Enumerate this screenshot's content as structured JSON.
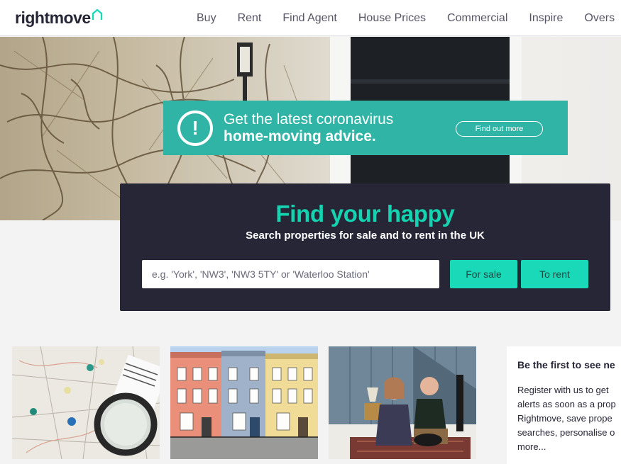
{
  "header": {
    "logo_text": "rightmove",
    "nav": [
      "Buy",
      "Rent",
      "Find Agent",
      "House Prices",
      "Commercial",
      "Inspire",
      "Overs"
    ]
  },
  "covid_banner": {
    "line1": "Get the latest coronavirus",
    "line2": "home-moving advice.",
    "button": "Find out more",
    "icon": "exclamation-icon"
  },
  "search": {
    "title": "Find your happy",
    "subtitle": "Search properties for sale and to rent in the UK",
    "placeholder": "e.g. 'York', 'NW3', 'NW3 5TY' or 'Waterloo Station'",
    "value": "",
    "for_sale": "For sale",
    "to_rent": "To rent"
  },
  "side_box": {
    "title": "Be the first to see ne",
    "lines": [
      "Register with us to get",
      "alerts as soon as a prop",
      "Rightmove, save prope",
      "searches, personalise o",
      "more..."
    ]
  },
  "colors": {
    "brand_teal": "#14d3b1",
    "banner_teal": "#30b4a6",
    "dark_navy": "#262637"
  }
}
